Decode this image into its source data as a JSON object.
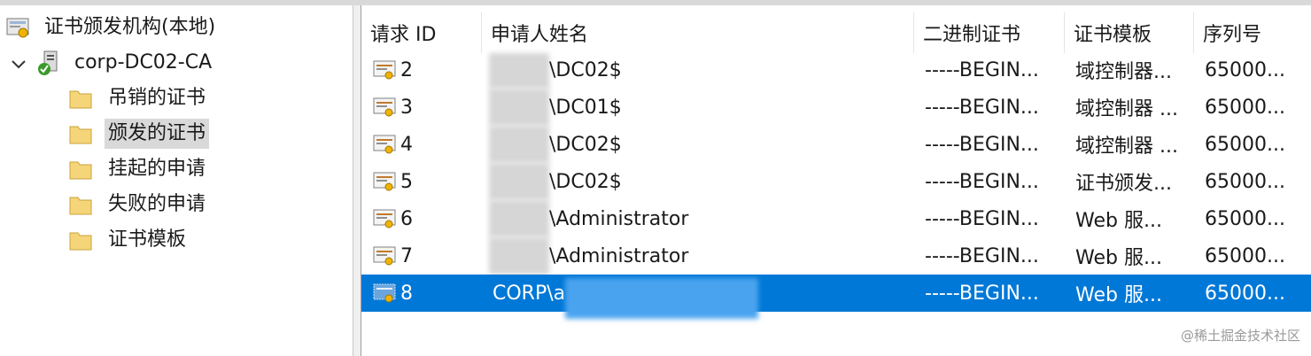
{
  "tree": {
    "root_label": "证书颁发机构(本地)",
    "ca_label": "corp-DC02-CA",
    "children": [
      {
        "label": "吊销的证书",
        "selected": false
      },
      {
        "label": "颁发的证书",
        "selected": true
      },
      {
        "label": "挂起的申请",
        "selected": false
      },
      {
        "label": "失败的申请",
        "selected": false
      },
      {
        "label": "证书模板",
        "selected": false
      }
    ]
  },
  "list": {
    "columns": [
      "请求 ID",
      "申请人姓名",
      "二进制证书",
      "证书模板",
      "序列号"
    ],
    "rows": [
      {
        "id": "2",
        "name": "\\DC02$",
        "binary": "-----BEGIN...",
        "template": "域控制器...",
        "serial": "65000..."
      },
      {
        "id": "3",
        "name": "\\DC01$",
        "binary": "-----BEGIN...",
        "template": "域控制器 ...",
        "serial": "65000..."
      },
      {
        "id": "4",
        "name": "\\DC02$",
        "binary": "-----BEGIN...",
        "template": "域控制器 ...",
        "serial": "65000..."
      },
      {
        "id": "5",
        "name": "\\DC02$",
        "binary": "-----BEGIN...",
        "template": "证书颁发...",
        "serial": "65000..."
      },
      {
        "id": "6",
        "name": "\\Administrator",
        "binary": "-----BEGIN...",
        "template": "Web 服...",
        "serial": "65000..."
      },
      {
        "id": "7",
        "name": "\\Administrator",
        "binary": "-----BEGIN...",
        "template": "Web 服...",
        "serial": "65000..."
      },
      {
        "id": "8",
        "name": "CORP\\a",
        "binary": "-----BEGIN...",
        "template": "Web 服...",
        "serial": "65000...",
        "selected": true
      }
    ]
  },
  "watermark": "@稀土掘金技术社区",
  "colors": {
    "selection": "#0078d7",
    "folder": "#f5d57a",
    "tree_selection": "#d9d9d9"
  }
}
